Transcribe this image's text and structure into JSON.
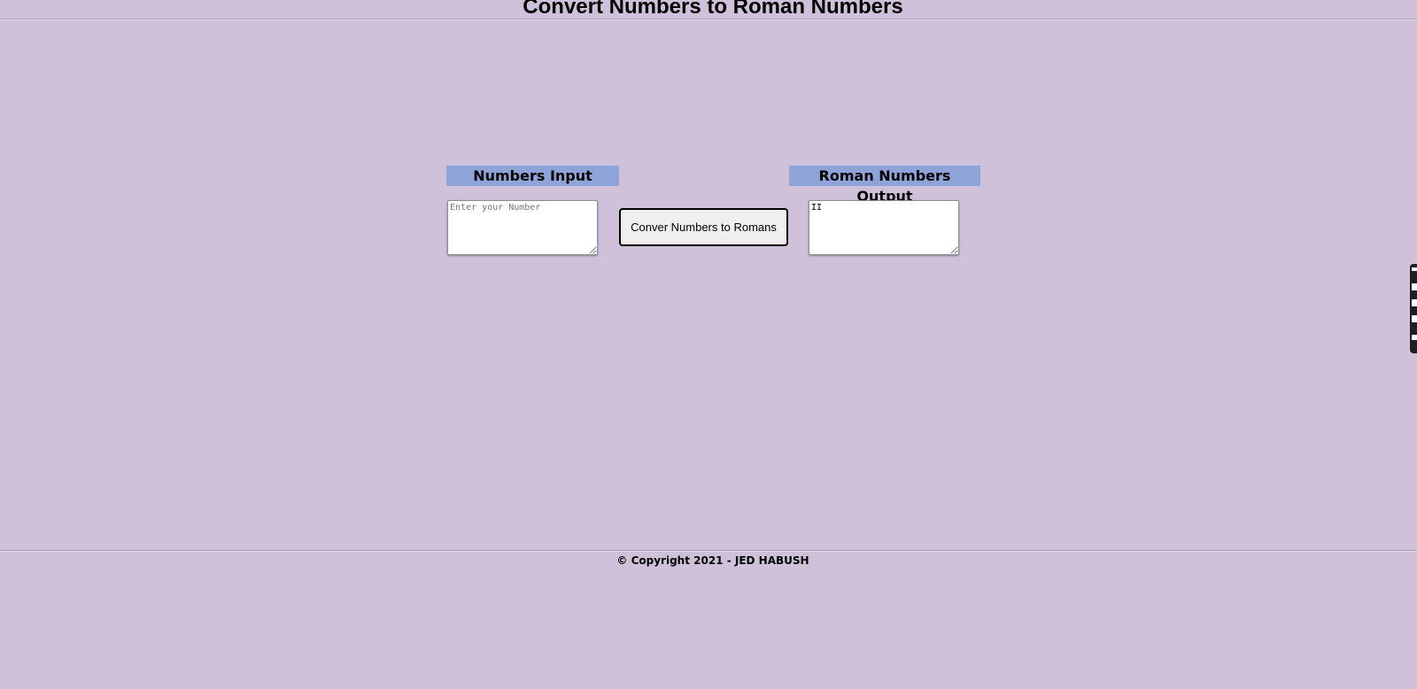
{
  "page": {
    "title": "Convert Numbers to Roman Numbers",
    "background_color": "#cfc1da"
  },
  "input_panel": {
    "label": "Numbers Input",
    "placeholder": "Enter your Number",
    "value": "",
    "label_color": "#8ea4d8"
  },
  "convert": {
    "button_label": "Conver Numbers to Romans"
  },
  "output_panel": {
    "label": "Roman Numbers Output",
    "value": "II",
    "label_color": "#8ea4d8"
  },
  "footer": {
    "text": "© Copyright 2021 - JED HABUSH"
  },
  "side_widget": {
    "icon": "floating-toolbar-icon"
  }
}
